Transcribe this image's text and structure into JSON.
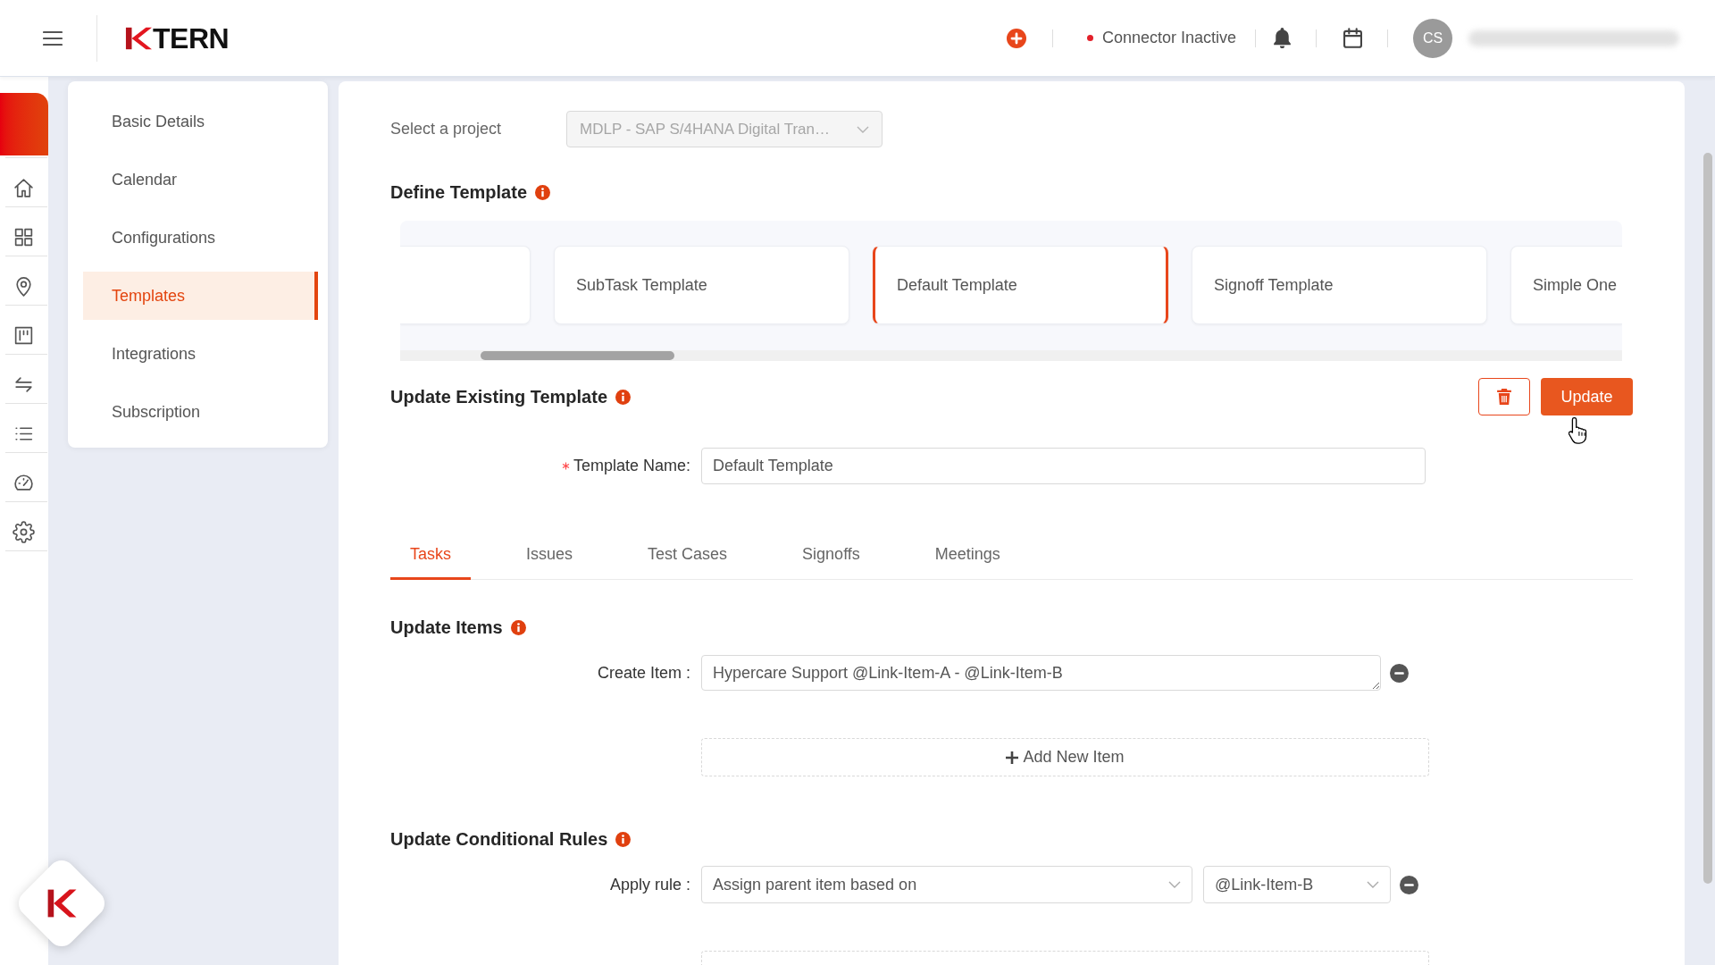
{
  "header": {
    "logo_text": "TERN",
    "connector": {
      "label": "Connector Inactive",
      "active": false
    },
    "avatar": {
      "initials": "CS"
    }
  },
  "settings_menu": {
    "items": [
      {
        "label": "Basic Details",
        "selected": false
      },
      {
        "label": "Calendar",
        "selected": false
      },
      {
        "label": "Configurations",
        "selected": false
      },
      {
        "label": "Templates",
        "selected": true
      },
      {
        "label": "Integrations",
        "selected": false
      },
      {
        "label": "Subscription",
        "selected": false
      }
    ]
  },
  "project_select": {
    "label": "Select a project",
    "value": "MDLP - SAP S/4HANA Digital Tran…",
    "disabled": true
  },
  "define_template": {
    "title": "Define Template",
    "templates": [
      {
        "selected": false
      },
      {
        "label": "SubTask Template",
        "selected": false
      },
      {
        "label": "Default Template",
        "selected": true
      },
      {
        "label": "Signoff Template",
        "selected": false
      },
      {
        "label": "Simple One",
        "selected": false
      }
    ]
  },
  "update_template": {
    "title": "Update Existing Template",
    "update_button": "Update",
    "name_field": {
      "label": "Template Name:",
      "required": true,
      "value": "Default Template"
    }
  },
  "tabs": [
    {
      "label": "Tasks",
      "selected": true
    },
    {
      "label": "Issues",
      "selected": false
    },
    {
      "label": "Test Cases",
      "selected": false
    },
    {
      "label": "Signoffs",
      "selected": false
    },
    {
      "label": "Meetings",
      "selected": false
    }
  ],
  "update_items": {
    "title": "Update Items",
    "items": [
      {
        "label": "Create Item :",
        "value": "Hypercare Support @Link-Item-A - @Link-Item-B"
      }
    ],
    "add_button": "Add New Item"
  },
  "conditional_rules": {
    "title": "Update Conditional Rules",
    "rules": [
      {
        "label": "Apply rule :",
        "rule": "Assign parent item based on",
        "target": "@Link-Item-B"
      }
    ]
  }
}
